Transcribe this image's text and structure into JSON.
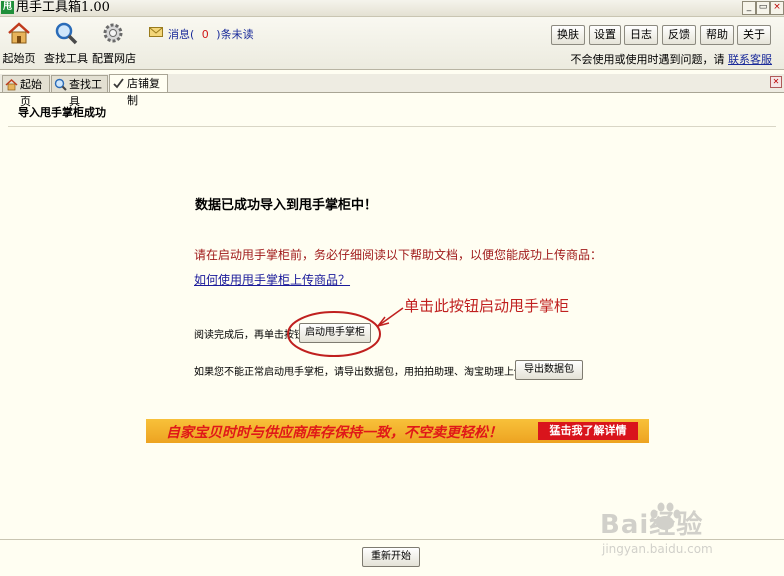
{
  "window": {
    "title": "甩手工具箱1.00",
    "app_icon_text": "甩",
    "min": "_",
    "max": "▭",
    "close": "×"
  },
  "toolbar": {
    "tools": [
      {
        "label": "起始页",
        "icon": "home-icon"
      },
      {
        "label": "查找工具",
        "icon": "search-icon"
      },
      {
        "label": "配置网店",
        "icon": "gear-icon"
      }
    ],
    "message": {
      "prefix": "消息(",
      "count": "0",
      "suffix": ")条未读"
    },
    "buttons": [
      "换肤",
      "设置",
      "日志",
      "反馈",
      "帮助",
      "关于"
    ],
    "help_text": "不会使用或使用时遇到问题，请",
    "help_link": "联系客服"
  },
  "tabs": [
    {
      "label": "起始页",
      "icon": "home-icon"
    },
    {
      "label": "查找工具",
      "icon": "search-icon"
    },
    {
      "label": "店铺复制",
      "icon": "check-icon",
      "active": true
    }
  ],
  "content": {
    "section_title": "导入甩手掌柜成功",
    "headline": "数据已成功导入到甩手掌柜中！",
    "instruction": "请在启动甩手掌柜前，务必仔细阅读以下帮助文档，以便您能成功上传商品：",
    "help_link": "如何使用甩手掌柜上传商品？",
    "read_text": "阅读完成后，再单击按钮",
    "launch_button": "启动甩手掌柜",
    "annotation": "单击此按钮启动甩手掌柜",
    "alt_text": "如果您不能正常启动甩手掌柜，请导出数据包，用拍拍助理、淘宝助理上传。",
    "export_button": "导出数据包",
    "banner_text": "自家宝贝时时与供应商库存保持一致，不空卖更轻松！",
    "banner_button": "猛击我了解详情",
    "restart_button": "重新开始"
  },
  "watermark": {
    "text": "Bai经验",
    "url_text": "jingyan.baidu.com"
  },
  "colors": {
    "accent_red": "#c0201f",
    "link_blue": "#1a2b9a",
    "banner_orange": "#eda321"
  }
}
